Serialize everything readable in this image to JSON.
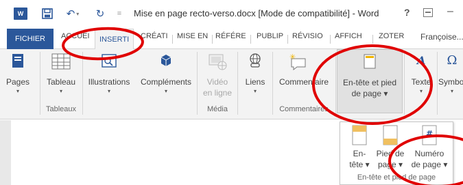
{
  "window": {
    "title": "Mise en page recto-verso.docx [Mode de compatibilité] - Word",
    "app_logo_text": "W",
    "help": "?",
    "minimize": "–"
  },
  "tabs": [
    "FICHIER",
    "ACCUEI",
    "INSERTI",
    "CRÉATI",
    "MISE EN",
    "RÉFÉRE",
    "PUBLIP",
    "RÉVISIO",
    "AFFICH",
    "ZOTER"
  ],
  "user": "Françoise...",
  "ribbon": {
    "pages": {
      "label": "Pages"
    },
    "tableau": {
      "label": "Tableau"
    },
    "illustrations": {
      "label": "Illustrations"
    },
    "complements": {
      "label": "Compléments"
    },
    "video": {
      "line1": "Vidéo",
      "line2": "en ligne"
    },
    "liens": {
      "label": "Liens"
    },
    "commentaire": {
      "label": "Commentaire"
    },
    "entete": {
      "line1": "En-tête et pied",
      "line2": "de page ▾"
    },
    "texte": {
      "label": "Texte"
    },
    "symboles": {
      "label": "Symbo"
    }
  },
  "groups": {
    "tableaux": "Tableaux",
    "media": "Média",
    "commentaires": "Commentaires"
  },
  "dropdown": {
    "entete": {
      "line1": "En-",
      "line2": "tête ▾"
    },
    "pied": {
      "line1": "Pied de",
      "line2": "page ▾"
    },
    "numero": {
      "line1": "Numéro",
      "line2": "de page ▾"
    },
    "group_label": "En-tête et pied de page",
    "number_symbol": "#"
  },
  "colors": {
    "word_blue": "#2b579a",
    "annotation_red": "#e00000"
  }
}
